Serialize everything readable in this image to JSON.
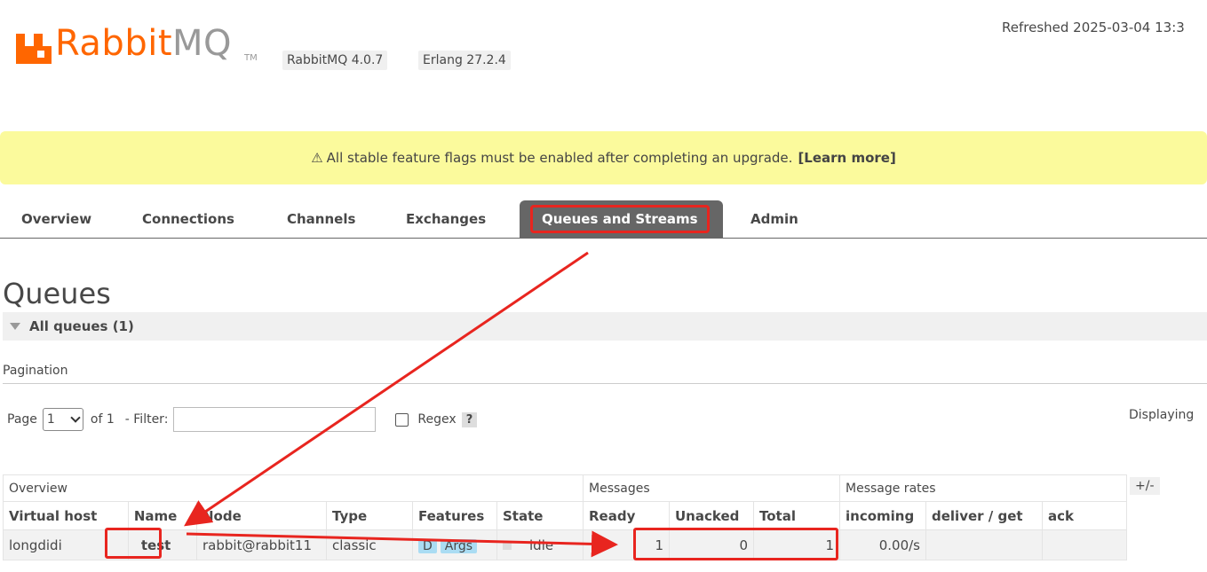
{
  "header": {
    "logo_rabbit": "Rabbit",
    "logo_mq": "MQ",
    "logo_tm": "TM",
    "version_rabbitmq": "RabbitMQ 4.0.7",
    "version_erlang": "Erlang 27.2.4",
    "refreshed": "Refreshed 2025-03-04 13:3"
  },
  "banner": {
    "warning_icon": "⚠",
    "message": "All stable feature flags must be enabled after completing an upgrade.",
    "link": "[Learn more]"
  },
  "tabs": [
    {
      "label": "Overview"
    },
    {
      "label": "Connections"
    },
    {
      "label": "Channels"
    },
    {
      "label": "Exchanges"
    },
    {
      "label": "Queues and Streams",
      "active": true
    },
    {
      "label": "Admin"
    }
  ],
  "page": {
    "title": "Queues",
    "section": "All queues (1)",
    "pagination_label": "Pagination",
    "page_label": "Page",
    "page_value": "1",
    "of_label": "of 1",
    "filter_label": "- Filter:",
    "filter_value": "",
    "regex_label": "Regex",
    "help": "?",
    "displaying": "Displaying"
  },
  "table": {
    "groups": [
      "Overview",
      "Messages",
      "Message rates"
    ],
    "toggle": "+/-",
    "headers": [
      "Virtual host",
      "Name",
      "Node",
      "Type",
      "Features",
      "State",
      "Ready",
      "Unacked",
      "Total",
      "incoming",
      "deliver / get",
      "ack"
    ],
    "row": {
      "vhost": "longdidi",
      "name": "test",
      "node": "rabbit@rabbit11",
      "type": "classic",
      "feature_d": "D",
      "feature_args": "Args",
      "state": "idle",
      "ready": "1",
      "unacked": "0",
      "total": "1",
      "incoming": "0.00/s",
      "deliver_get": "",
      "ack": ""
    }
  },
  "colors": {
    "brand": "#ff6600",
    "banner": "#fbfa9c",
    "annotation": "#e8251f",
    "feature_pill": "#aadcf3"
  }
}
